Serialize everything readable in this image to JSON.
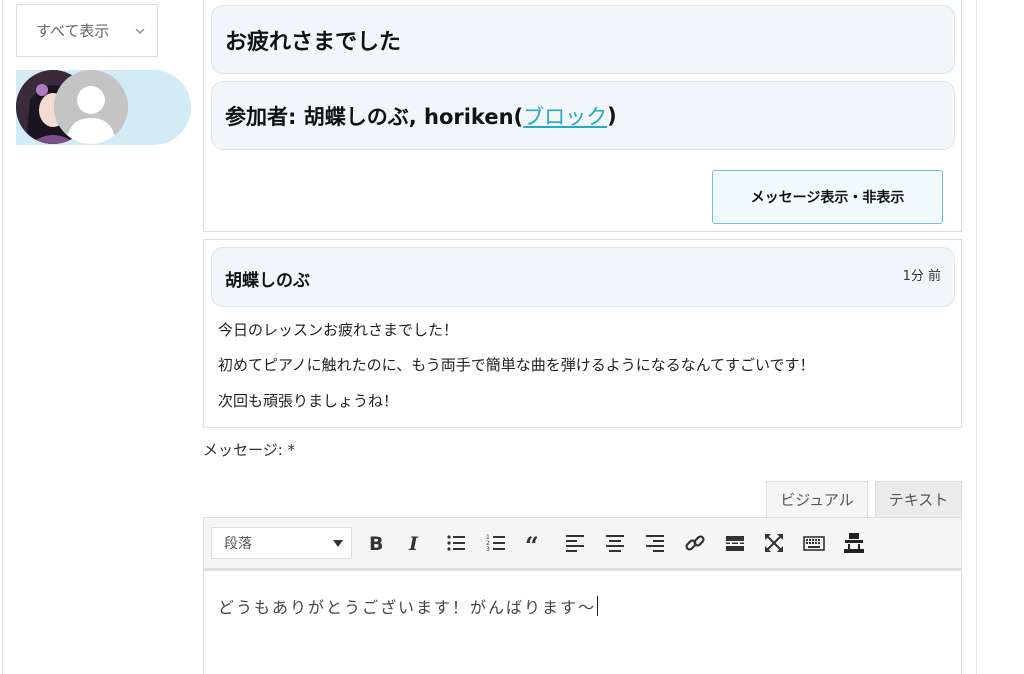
{
  "sidebar": {
    "filter_label": "すべて表示"
  },
  "thread": {
    "subject": "お疲れさまでした",
    "participants_prefix": "参加者: 胡蝶しのぶ, horiken(",
    "block_link": "ブロック",
    "participants_suffix": ")",
    "toggle_button": "メッセージ表示・非表示"
  },
  "message": {
    "sender": "胡蝶しのぶ",
    "time": "1分 前",
    "lines": [
      "今日のレッスンお疲れさまでした！",
      "初めてピアノに触れたのに、もう両手で簡単な曲を弾けるようになるなんてすごいです！",
      "次回も頑張りましょうね！"
    ]
  },
  "compose": {
    "label": "メッセージ: *",
    "tabs": [
      "ビジュアル",
      "テキスト"
    ],
    "format_value": "段落",
    "toolbar_icons": [
      "bold-icon",
      "italic-icon",
      "bullet-list-icon",
      "numbered-list-icon",
      "blockquote-icon",
      "align-left-icon",
      "align-center-icon",
      "align-right-icon",
      "link-icon",
      "read-more-icon",
      "fullscreen-icon",
      "keyboard-icon",
      "toolbar-toggle-icon"
    ],
    "editor_text": "どうもありがとうございます！がんばります〜"
  }
}
